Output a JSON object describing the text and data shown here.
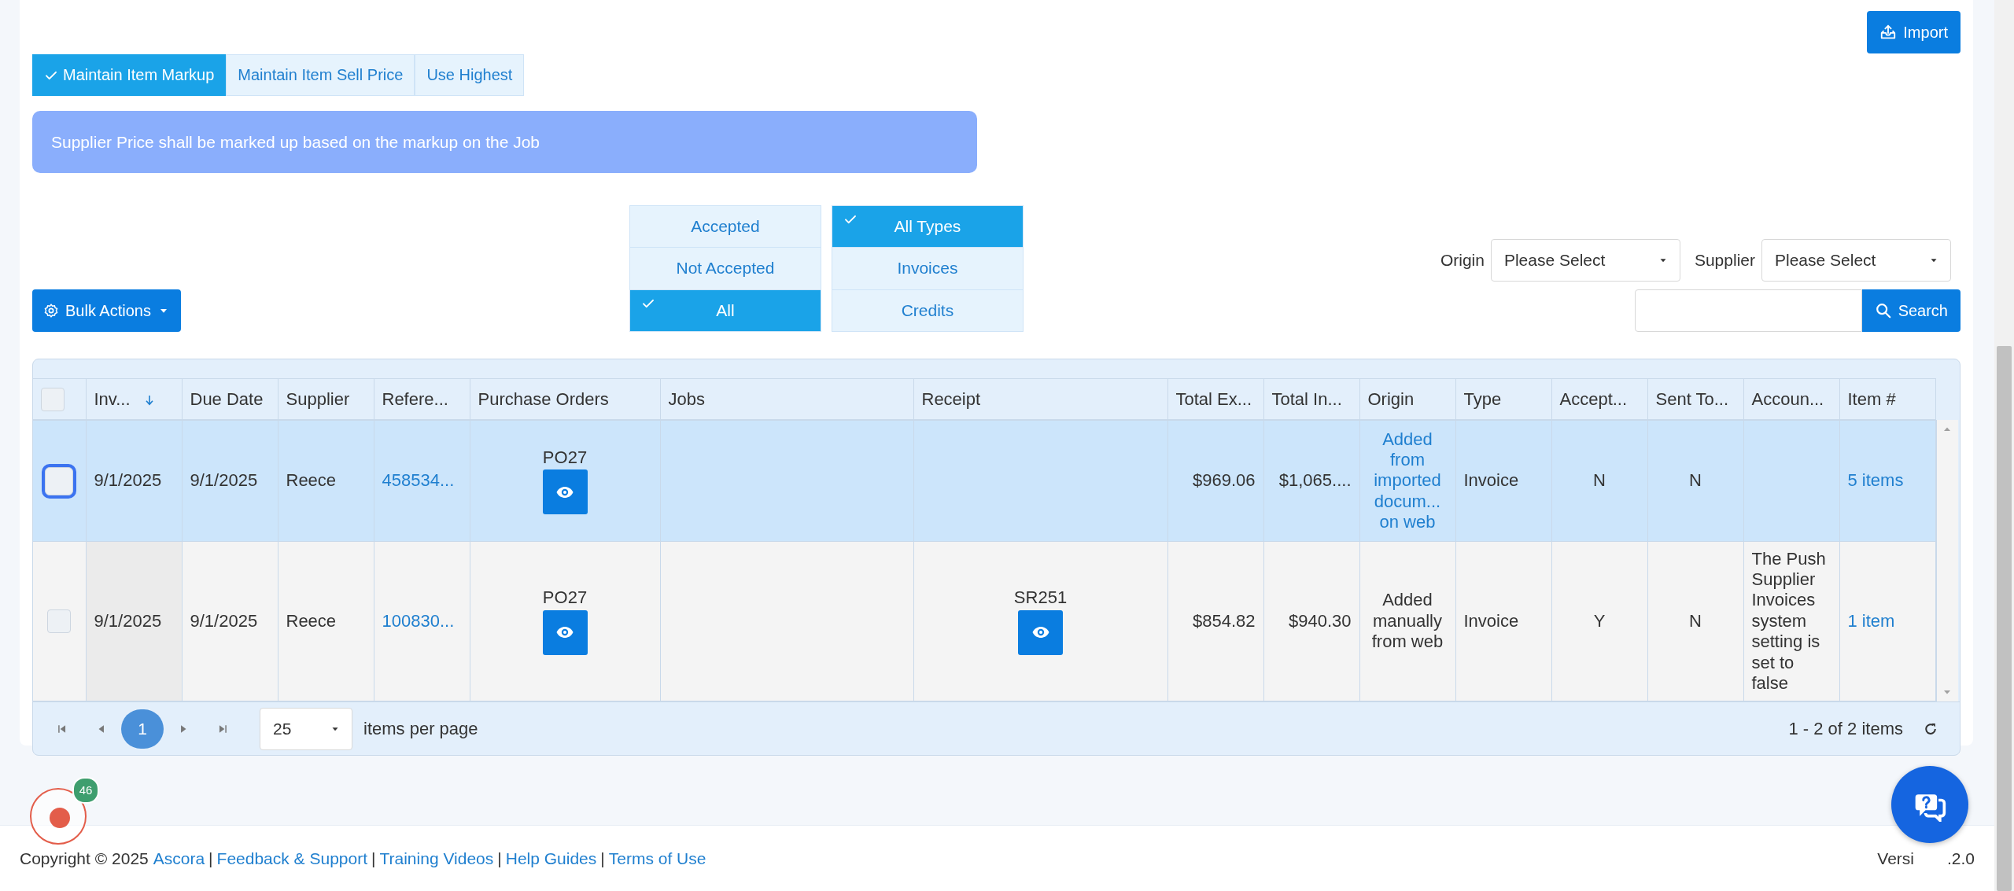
{
  "import_button": {
    "label": "Import"
  },
  "pricing_modes": [
    {
      "label": "Maintain Item Markup",
      "selected": true
    },
    {
      "label": "Maintain Item Sell Price",
      "selected": false
    },
    {
      "label": "Use Highest",
      "selected": false
    }
  ],
  "info_message": "Supplier Price shall be marked up based on the markup on the Job",
  "bulk_actions": {
    "label": "Bulk Actions"
  },
  "acceptance_filter": [
    {
      "label": "Accepted",
      "selected": false
    },
    {
      "label": "Not Accepted",
      "selected": false
    },
    {
      "label": "All",
      "selected": true
    }
  ],
  "type_filter": [
    {
      "label": "All Types",
      "selected": true
    },
    {
      "label": "Invoices",
      "selected": false
    },
    {
      "label": "Credits",
      "selected": false
    }
  ],
  "origin_filter": {
    "label": "Origin",
    "value": "Please Select"
  },
  "supplier_filter": {
    "label": "Supplier",
    "value": "Please Select"
  },
  "search": {
    "button": "Search"
  },
  "table": {
    "header_checkbox": {
      "checked": false
    },
    "columns": [
      {
        "label": "Inv...",
        "sorted": true
      },
      {
        "label": "Due Date",
        "sorted": false
      },
      {
        "label": "Supplier",
        "sorted": false
      },
      {
        "label": "Refere...",
        "sorted": false
      },
      {
        "label": "Purchase Orders",
        "sorted": false
      },
      {
        "label": "Jobs",
        "sorted": false
      },
      {
        "label": "Receipt",
        "sorted": false
      },
      {
        "label": "Total Ex...",
        "sorted": false
      },
      {
        "label": "Total In...",
        "sorted": false
      },
      {
        "label": "Origin",
        "sorted": false
      },
      {
        "label": "Type",
        "sorted": false
      },
      {
        "label": "Accept...",
        "sorted": false
      },
      {
        "label": "Sent To...",
        "sorted": false
      },
      {
        "label": "Accoun...",
        "sorted": false
      },
      {
        "label": "Item #",
        "sorted": false
      }
    ],
    "rows": [
      {
        "selected": true,
        "focused": true,
        "checked": false,
        "invoice_date": "9/1/2025",
        "due_date": "9/1/2025",
        "supplier": "Reece",
        "reference": "458534...",
        "purchase_order": "PO27",
        "total_ex": "$969.06",
        "total_inc": "$1,065....",
        "origin": "Added from imported docum... on web",
        "origin_link": true,
        "type": "Invoice",
        "accepted": "N",
        "sent_to": "N",
        "items": "5 items"
      },
      {
        "selected": false,
        "focused": false,
        "checked": false,
        "invoice_date": "9/1/2025",
        "due_date": "9/1/2025",
        "supplier": "Reece",
        "reference": "100830...",
        "purchase_order": "PO27",
        "receipt": "SR251",
        "total_ex": "$854.82",
        "total_inc": "$940.30",
        "origin": "Added manually from web",
        "origin_link": false,
        "type": "Invoice",
        "accepted": "Y",
        "sent_to": "N",
        "account": "The Push Supplier Invoices system setting is set to false",
        "items": "1 item"
      }
    ],
    "pager": {
      "pages": [
        {
          "label": "1",
          "selected": true
        }
      ],
      "page_size": "25",
      "page_size_label": "items per page",
      "summary": "1 - 2 of 2 items"
    }
  },
  "recorder": {
    "count": "46"
  },
  "footer": {
    "copyright": "Copyright © 2025",
    "separator": "|",
    "links": [
      "Ascora",
      "Feedback & Support",
      "Training Videos",
      "Help Guides",
      "Terms of Use"
    ],
    "version_start": "Versi",
    "version_end": ".2.0"
  }
}
